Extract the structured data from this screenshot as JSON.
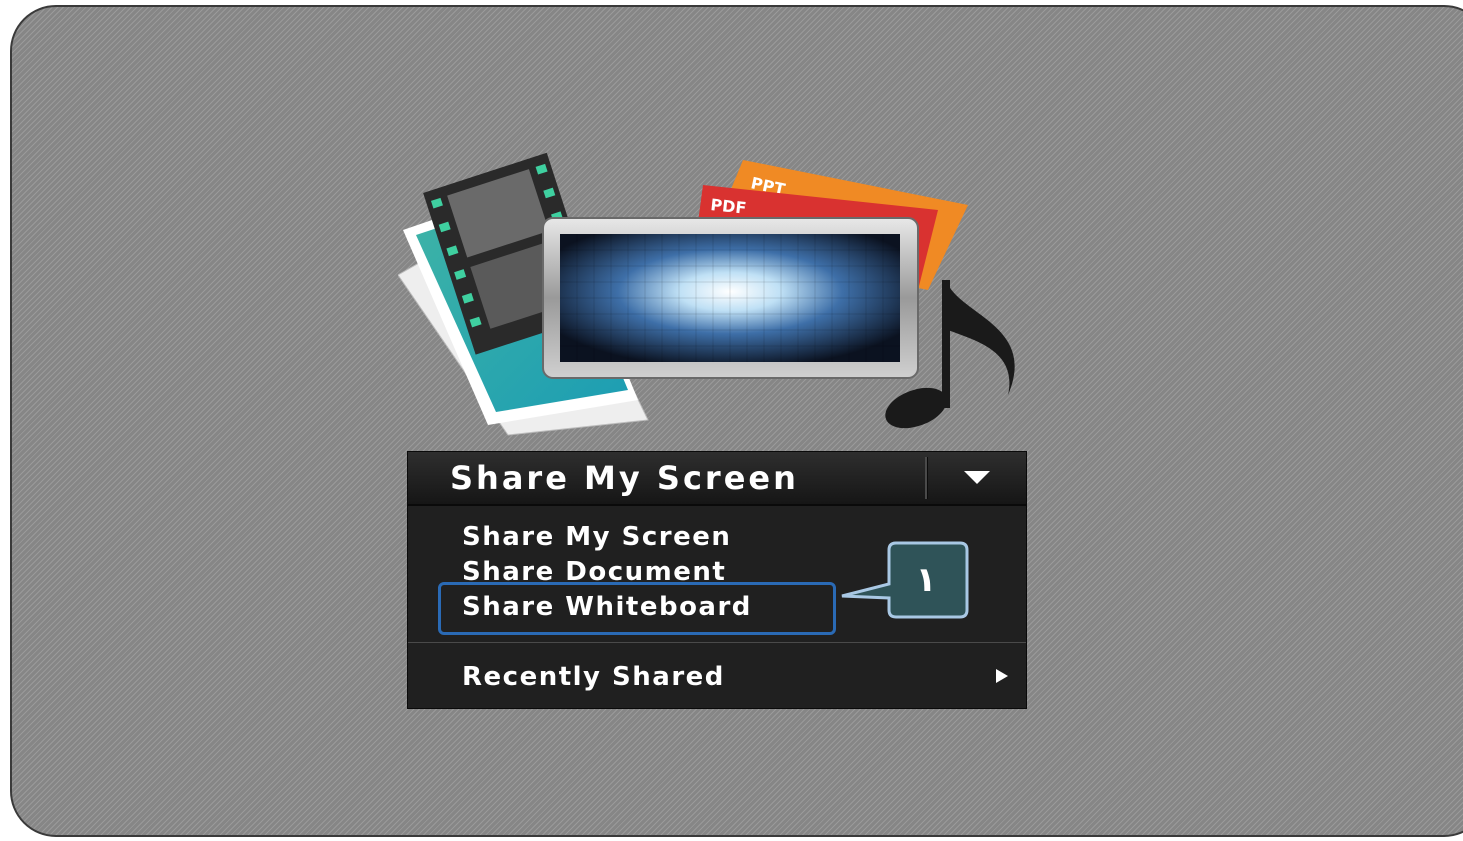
{
  "split_button": {
    "label": "Share My Screen",
    "dropdown_icon": "caret-down-icon"
  },
  "menu": {
    "items": [
      {
        "label": "Share My Screen"
      },
      {
        "label": "Share Document"
      },
      {
        "label": "Share Whiteboard"
      },
      {
        "label": "Recently Shared",
        "submenu_icon": "caret-right-icon"
      }
    ]
  },
  "artwork": {
    "ppt_label": "PPT",
    "pdf_label": "PDF"
  },
  "callout": {
    "number": "١"
  },
  "colors": {
    "highlight": "#2a6ab5",
    "callout_fill": "#2f5358",
    "callout_border": "#a9c8e4",
    "menu_bg": "#202020"
  }
}
